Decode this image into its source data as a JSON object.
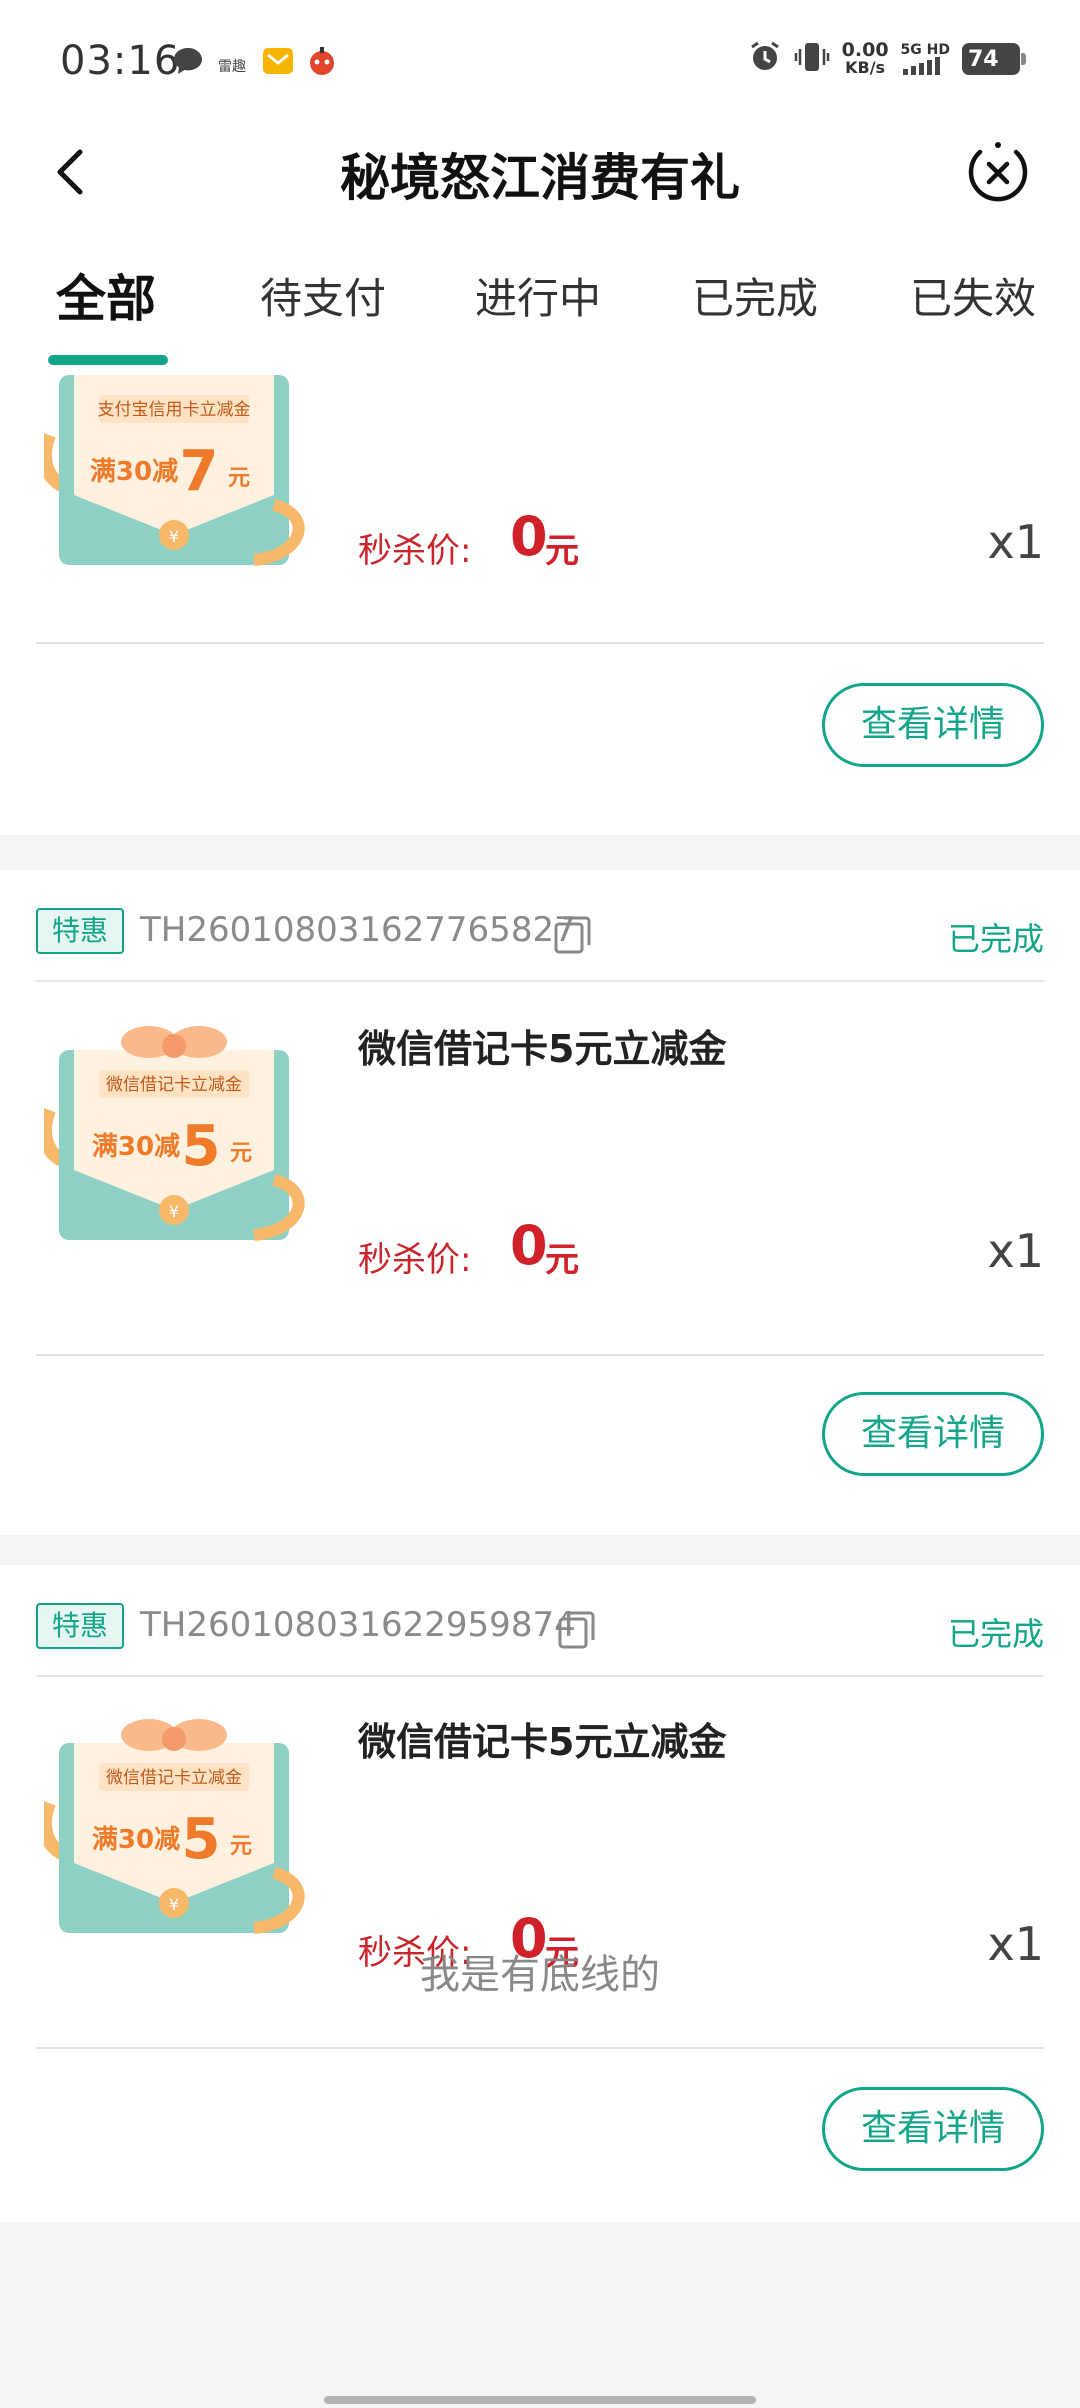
{
  "status_bar": {
    "time": "03:16",
    "net_speed_value": "0.00",
    "net_speed_unit": "KB/s",
    "net_type": "5G HD",
    "battery": "74",
    "notif_app_label": "雷趣"
  },
  "nav": {
    "title": "秘境怒江消费有礼"
  },
  "tabs": [
    "全部",
    "待支付",
    "进行中",
    "已完成",
    "已失效"
  ],
  "orders": [
    {
      "coupon": {
        "brand": "支付宝信用卡立减金",
        "threshold": "满30减",
        "amount": "7",
        "unit": "元",
        "coin": "¥"
      },
      "price_label": "秒杀价:",
      "price": "0",
      "price_unit": "元",
      "qty": "x1",
      "button": "查看详情"
    },
    {
      "badge": "特惠",
      "order_no": "TH260108031627765827",
      "status": "已完成",
      "name": "微信借记卡5元立减金",
      "coupon": {
        "brand": "微信借记卡立减金",
        "threshold": "满30减",
        "amount": "5",
        "unit": "元",
        "coin": "¥"
      },
      "price_label": "秒杀价:",
      "price": "0",
      "price_unit": "元",
      "qty": "x1",
      "button": "查看详情"
    },
    {
      "badge": "特惠",
      "order_no": "TH260108031622959874",
      "status": "已完成",
      "name": "微信借记卡5元立减金",
      "coupon": {
        "brand": "微信借记卡立减金",
        "threshold": "满30减",
        "amount": "5",
        "unit": "元",
        "coin": "¥"
      },
      "price_label": "秒杀价:",
      "price": "0",
      "price_unit": "元",
      "qty": "x1",
      "button": "查看详情"
    }
  ],
  "footer": "我是有底线的",
  "colors": {
    "accent": "#12a58a",
    "price": "#d0202a"
  }
}
